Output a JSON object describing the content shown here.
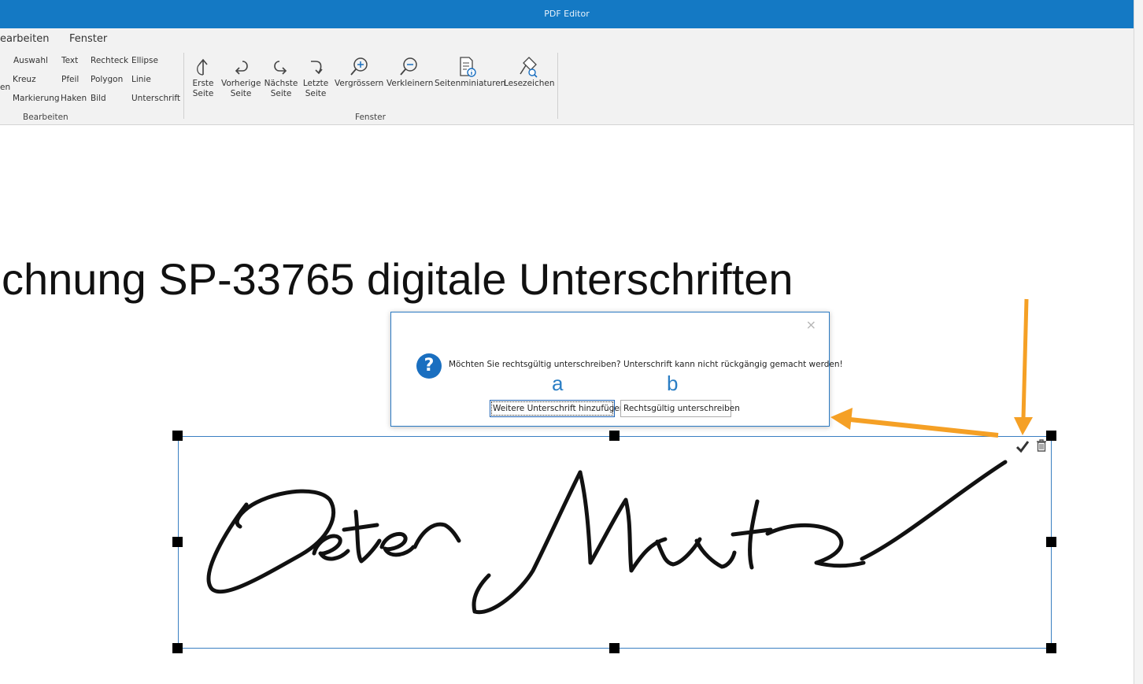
{
  "window": {
    "title": "PDF Editor"
  },
  "menu": {
    "items": [
      "earbeiten",
      "Fenster"
    ]
  },
  "ribbon": {
    "partial_left": "en",
    "bearbeiten": {
      "col1": [
        "Auswahl",
        "Kreuz",
        "Markierung"
      ],
      "col2": [
        "Text",
        "Pfeil",
        "Haken"
      ],
      "col3": [
        "Rechteck",
        "Polygon",
        "Bild"
      ],
      "col4": [
        "Ellipse",
        "Linie",
        "Unterschrift"
      ],
      "group_label": "Bearbeiten"
    },
    "fenster": {
      "buttons": [
        {
          "icon": "first-page-icon",
          "line1": "Erste",
          "line2": "Seite"
        },
        {
          "icon": "previous-page-icon",
          "line1": "Vorherige",
          "line2": "Seite"
        },
        {
          "icon": "next-page-icon",
          "line1": "Nächste",
          "line2": "Seite"
        },
        {
          "icon": "last-page-icon",
          "line1": "Letzte",
          "line2": "Seite"
        },
        {
          "icon": "zoom-in-icon",
          "line1": "Vergrössern",
          "line2": ""
        },
        {
          "icon": "zoom-out-icon",
          "line1": "Verkleinern",
          "line2": ""
        },
        {
          "icon": "thumbnails-icon",
          "line1": "Seitenminiaturen",
          "line2": ""
        },
        {
          "icon": "bookmark-icon",
          "line1": "Lesezeichen",
          "line2": ""
        }
      ],
      "group_label": "Fenster"
    }
  },
  "document": {
    "heading": "chnung SP-33765 digitale Unterschriften"
  },
  "signature": {
    "actions": [
      "confirm-check-icon",
      "delete-trash-icon"
    ]
  },
  "dialog": {
    "icon": "question-icon",
    "message": "Möchten Sie rechtsgültig unterschreiben? Unterschrift kann nicht rückgängig gemacht werden!",
    "button_a": "Weitere Unterschrift hinzufügen",
    "button_b": "Rechtsgültig unterschreiben",
    "close_glyph": "×"
  },
  "annotations": {
    "label_a": "a",
    "label_b": "b",
    "arrow_color": "#f5a025"
  },
  "colors": {
    "titlebar": "#1479c4",
    "selection": "#3a7fc2",
    "dialog_icon": "#1a6fc0"
  }
}
